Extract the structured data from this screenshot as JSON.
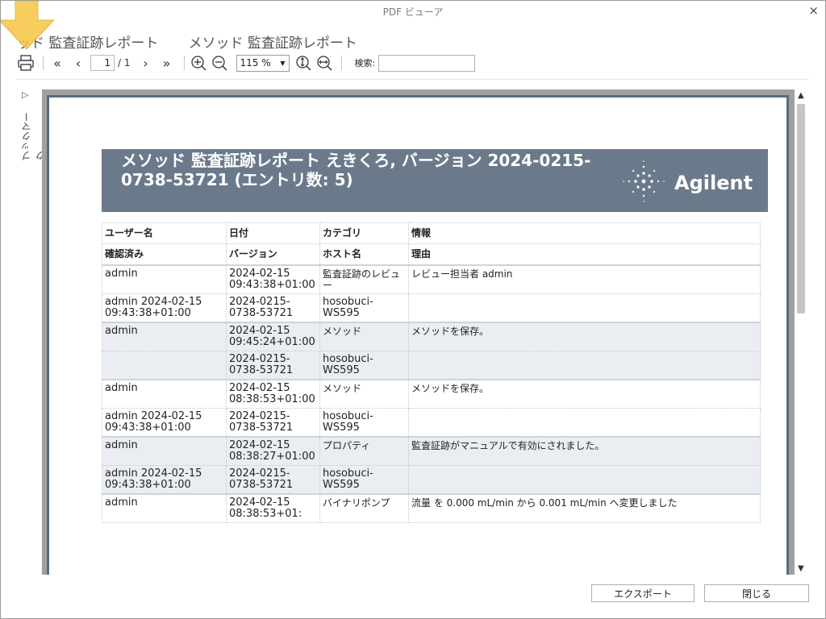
{
  "window": {
    "title": "PDF ビューア",
    "close_glyph": "×"
  },
  "header": {
    "title_partial": "ッド 監査証跡レポート",
    "title_full": "メソッド 監査証跡レポート"
  },
  "toolbar": {
    "page_current": "1",
    "page_total": "/ 1",
    "zoom": "115 %",
    "search_label": "検索:",
    "search_value": ""
  },
  "bookmark": {
    "label": "ブックマーク",
    "arrow": "▷"
  },
  "report": {
    "title": "メソッド 監査証跡レポート えきくろ, バージョン 2024-0215-0738-53721 (エントリ数: 5)",
    "logo_text": "Agilent",
    "header_row1": [
      "ユーザー名",
      "日付",
      "カテゴリ",
      "情報"
    ],
    "header_row2": [
      "確認済み",
      "バージョン",
      "ホスト名",
      "理由"
    ],
    "entries": [
      {
        "user": "admin",
        "date": "2024-02-15 09:43:38+01:00",
        "category": "監査証跡のレビュー",
        "info": "レビュー担当者 admin",
        "confirmed": "admin 2024-02-15 09:43:38+01:00",
        "version": "2024-0215-0738-53721",
        "host": "hosobuci-WS595",
        "reason": ""
      },
      {
        "user": "admin",
        "date": "2024-02-15 09:45:24+01:00",
        "category": "メソッド",
        "info": "メソッドを保存。",
        "confirmed": "",
        "version": "2024-0215-0738-53721",
        "host": "hosobuci-WS595",
        "reason": ""
      },
      {
        "user": "admin",
        "date": "2024-02-15 08:38:53+01:00",
        "category": "メソッド",
        "info": "メソッドを保存。",
        "confirmed": "admin 2024-02-15 09:43:38+01:00",
        "version": "2024-0215-0738-53721",
        "host": "hosobuci-WS595",
        "reason": ""
      },
      {
        "user": "admin",
        "date": "2024-02-15 08:38:27+01:00",
        "category": "プロパティ",
        "info": "監査証跡がマニュアルで有効にされました。",
        "confirmed": "admin 2024-02-15 09:43:38+01:00",
        "version": "2024-0215-0738-53721",
        "host": "hosobuci-WS595",
        "reason": ""
      },
      {
        "user": "admin",
        "date": "2024-02-15 08:38:53+01:",
        "category": "バイナリポンプ",
        "info": "流量 を 0.000 mL/min から 0.001 mL/min へ変更しました",
        "confirmed": "",
        "version": "",
        "host": "",
        "reason": ""
      }
    ]
  },
  "footer": {
    "export_label": "エクスポート",
    "close_label": "閉じる"
  },
  "colors": {
    "banner": "#6b7a8b",
    "page_border": "#5a6b80",
    "shade": "#eaeef3",
    "arrow": "#f5c542"
  }
}
